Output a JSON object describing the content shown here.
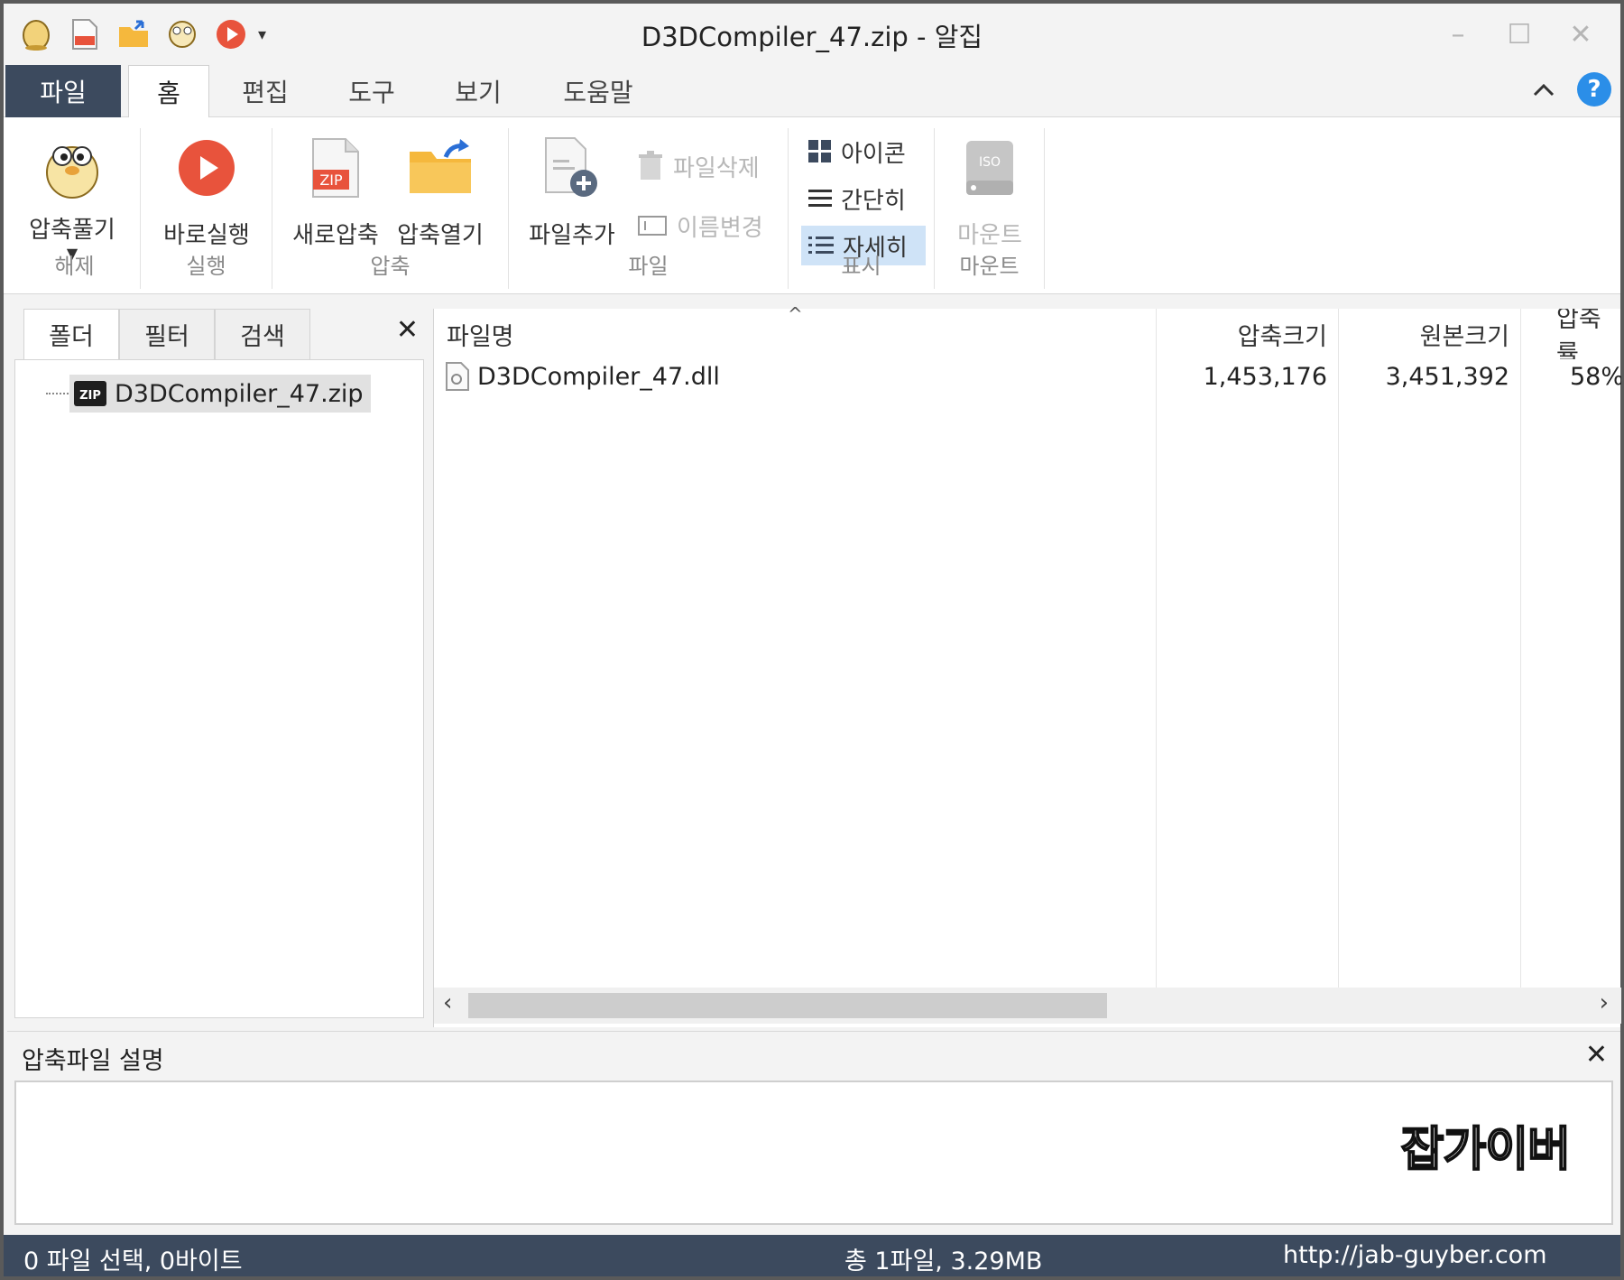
{
  "window": {
    "title": "D3DCompiler_47.zip - 알집"
  },
  "quick_access": {
    "icons": [
      "alzip-logo-icon",
      "new-zip-icon",
      "open-folder-icon",
      "extract-icon",
      "run-icon",
      "customize-dropdown-icon"
    ]
  },
  "tabs": [
    "파일",
    "홈",
    "편집",
    "도구",
    "보기",
    "도움말"
  ],
  "active_tab": "홈",
  "ribbon": {
    "extract": {
      "button": "압축풀기",
      "group": "해제"
    },
    "run": {
      "button": "바로실행",
      "group": "실행"
    },
    "compress": {
      "new_zip": "새로압축",
      "open_zip": "압축열기",
      "group": "압축"
    },
    "file": {
      "add": "파일추가",
      "delete": "파일삭제",
      "rename": "이름변경",
      "group": "파일"
    },
    "view": {
      "icons": "아이콘",
      "simple": "간단히",
      "details": "자세히",
      "group": "표시"
    },
    "mount": {
      "button": "마운트",
      "group": "마운트"
    },
    "iso_label": "ISO"
  },
  "left_panel": {
    "tabs": [
      "폴더",
      "필터",
      "검색"
    ],
    "tree_item": "D3DCompiler_47.zip",
    "zip_badge": "ZIP"
  },
  "file_list": {
    "columns": [
      "파일명",
      "압축크기",
      "원본크기",
      "압축률"
    ],
    "rows": [
      {
        "name": "D3DCompiler_47.dll",
        "packed": "1,453,176",
        "original": "3,451,392",
        "ratio": "58%"
      }
    ]
  },
  "description": {
    "title": "압축파일 설명",
    "watermark": "잡가이버"
  },
  "status": {
    "selection": "0 파일 선택,  0바이트",
    "total": "총 1파일,  3.29MB",
    "url": "http://jab-guyber.com"
  },
  "colors": {
    "accent_dark": "#3c4a5e",
    "selected": "#cfe3f7",
    "zip_red": "#e8533c",
    "folder": "#f5b83d",
    "help_blue": "#2b8ee8"
  }
}
